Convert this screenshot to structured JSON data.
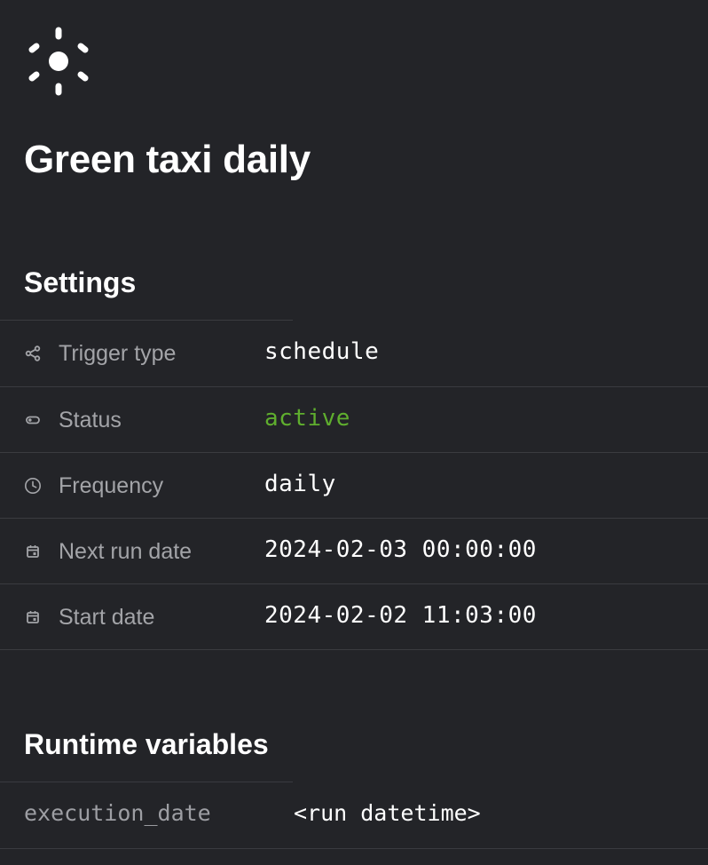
{
  "header": {
    "logo_icon": "sun-icon",
    "title": "Green taxi daily"
  },
  "settings": {
    "title": "Settings",
    "rows": [
      {
        "icon": "share-icon",
        "label": "Trigger type",
        "value": "schedule"
      },
      {
        "icon": "toggle-icon",
        "label": "Status",
        "value": "active",
        "value_color": "#5fae2e"
      },
      {
        "icon": "clock-icon",
        "label": "Frequency",
        "value": "daily"
      },
      {
        "icon": "calendar-icon",
        "label": "Next run date",
        "value": "2024-02-03 00:00:00"
      },
      {
        "icon": "calendar-icon",
        "label": "Start date",
        "value": "2024-02-02 11:03:00"
      }
    ]
  },
  "runtime_variables": {
    "title": "Runtime variables",
    "items": [
      {
        "name": "execution_date",
        "value": "<run datetime>"
      }
    ]
  },
  "colors": {
    "background": "#232428",
    "divider": "#3a3b40",
    "label": "#a3a4a8",
    "active": "#5fae2e"
  }
}
